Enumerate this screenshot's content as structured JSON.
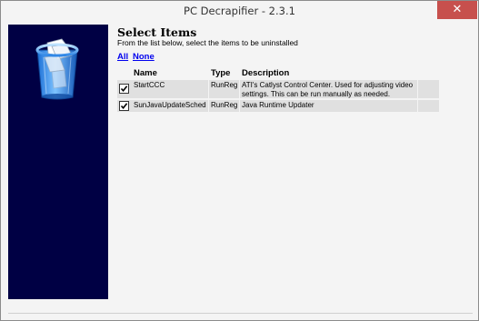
{
  "window": {
    "title": "PC Decrapifier - 2.3.1",
    "close_glyph": "✕"
  },
  "side_panel": {
    "icon": "recycle-bin-icon",
    "color": "#000044"
  },
  "main": {
    "heading": "Select Items",
    "subheading": "From the list below, select the items to be uninstalled",
    "links": {
      "all_label": "All",
      "none_label": "None"
    },
    "table": {
      "columns": [
        "Name",
        "Type",
        "Description"
      ],
      "rows": [
        {
          "checked": true,
          "name": "StartCCC",
          "type": "RunReg",
          "description_line1": "ATI's Catlyst Control Center. Used for adjusting video",
          "description_line2": "settings. This can be run manually as needed."
        },
        {
          "checked": true,
          "name": "SunJavaUpdateSched",
          "type": "RunReg",
          "description_line1": "Java Runtime Updater",
          "description_line2": ""
        }
      ]
    }
  },
  "colors": {
    "link": "#0000ee",
    "close_button": "#c7504d",
    "row_background": "#e0e0e0"
  }
}
